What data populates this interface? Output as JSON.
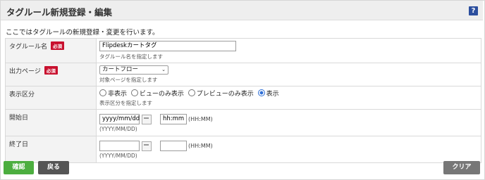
{
  "page": {
    "title": "タグルール新規登録・編集",
    "help_label": "?",
    "intro": "ここではタグルールの新規登録・変更を行います。"
  },
  "form": {
    "tag_rule_name": {
      "label": "タグルール名",
      "required": "必須",
      "value": "Flipdeskカートタグ",
      "hint": "タグルール名を指定します"
    },
    "output_page": {
      "label": "出力ページ",
      "required": "必須",
      "selected": "カートフロー",
      "hint": "対象ページを指定します"
    },
    "display_type": {
      "label": "表示区分",
      "options": [
        "非表示",
        "ビューのみ表示",
        "プレビューのみ表示",
        "表示"
      ],
      "selected_index": 3,
      "hint": "表示区分を指定します"
    },
    "start_date": {
      "label": "開始日",
      "date_value": "yyyy/mm/dd",
      "time_value": "hh:mm",
      "time_format": "(HH:MM)",
      "date_format": "(YYYY/MM/DD)"
    },
    "end_date": {
      "label": "終了日",
      "date_value": "",
      "time_value": "",
      "time_format": "(HH:MM)",
      "date_format": "(YYYY/MM/DD)"
    }
  },
  "buttons": {
    "confirm": "確認",
    "back": "戻る",
    "clear": "クリア"
  },
  "colors": {
    "confirm": "#4cae3f",
    "back": "#555555",
    "clear": "#777777",
    "required_badge": "#c8102e",
    "help": "#2c4f9e"
  }
}
